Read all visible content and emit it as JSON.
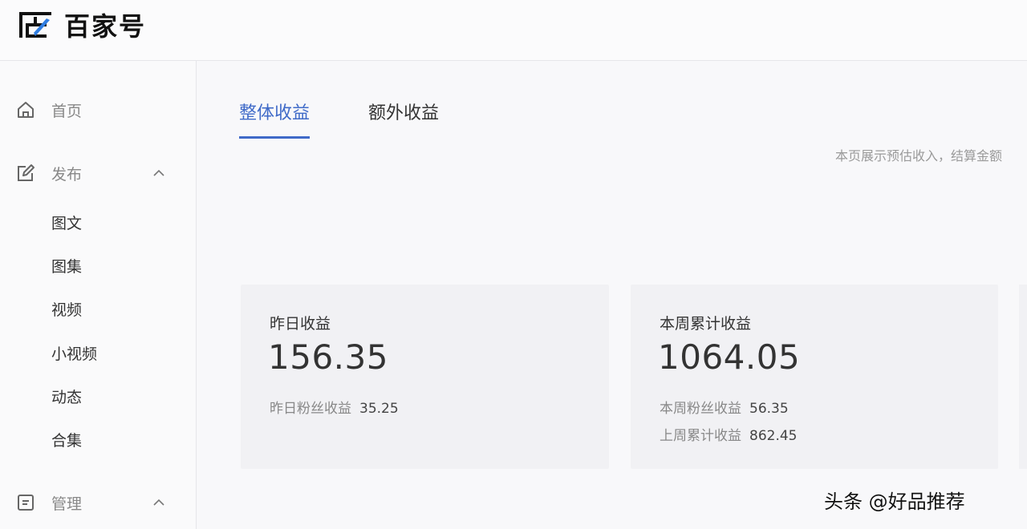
{
  "brand": {
    "name": "百家号",
    "logo_icon": "baijiahao-logo-icon"
  },
  "sidebar": {
    "home": {
      "label": "首页",
      "icon": "home-icon"
    },
    "publish": {
      "label": "发布",
      "icon": "edit-icon",
      "expanded": true,
      "items": [
        "图文",
        "图集",
        "视频",
        "小视频",
        "动态",
        "合集"
      ]
    },
    "manage": {
      "label": "管理",
      "icon": "document-icon",
      "expanded": true
    }
  },
  "tabs": [
    {
      "label": "整体收益",
      "active": true
    },
    {
      "label": "额外收益",
      "active": false
    }
  ],
  "notice": "本页展示预估收入，结算金额",
  "cards": [
    {
      "title": "昨日收益",
      "value": "156.35",
      "rows": [
        {
          "label": "昨日粉丝收益",
          "value": "35.25"
        }
      ]
    },
    {
      "title": "本周累计收益",
      "value": "1064.05",
      "rows": [
        {
          "label": "本周粉丝收益",
          "value": "56.35"
        },
        {
          "label": "上周累计收益",
          "value": "862.45"
        }
      ]
    }
  ],
  "watermark": "头条 @好品推荐",
  "colors": {
    "accent": "#3f6ac8",
    "card_bg": "#f1f1f4"
  }
}
